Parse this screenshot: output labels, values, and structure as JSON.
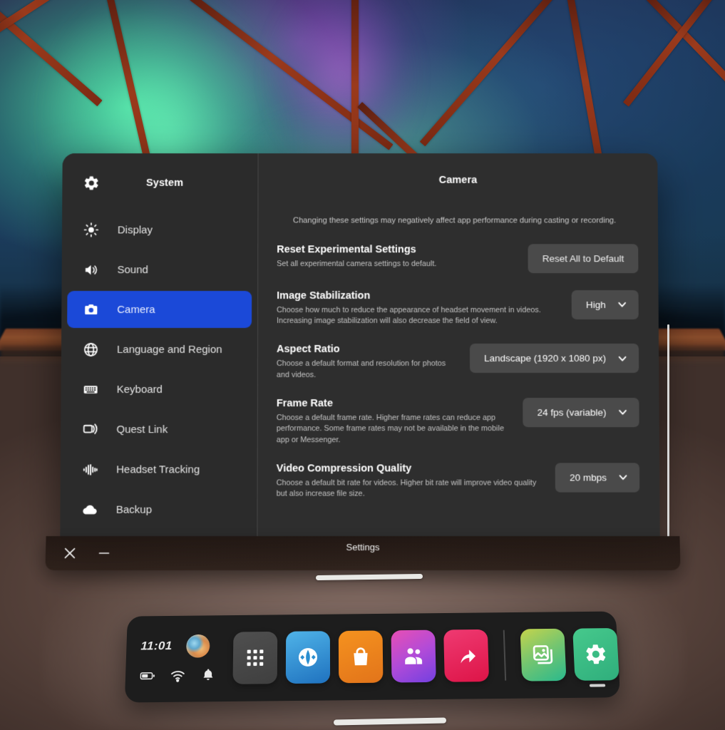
{
  "window": {
    "app_title": "Settings",
    "close_label": "×",
    "minimize_label": "–"
  },
  "sidebar": {
    "header": {
      "label": "System",
      "icon": "gear-icon"
    },
    "items": [
      {
        "label": "Display",
        "icon": "brightness-icon",
        "active": false
      },
      {
        "label": "Sound",
        "icon": "speaker-icon",
        "active": false
      },
      {
        "label": "Camera",
        "icon": "camera-icon",
        "active": true
      },
      {
        "label": "Language and Region",
        "icon": "globe-icon",
        "active": false
      },
      {
        "label": "Keyboard",
        "icon": "keyboard-icon",
        "active": false
      },
      {
        "label": "Quest Link",
        "icon": "cast-icon",
        "active": false
      },
      {
        "label": "Headset Tracking",
        "icon": "waveform-icon",
        "active": false
      },
      {
        "label": "Backup",
        "icon": "cloud-icon",
        "active": false
      }
    ],
    "active_color": "#1b49d8"
  },
  "content": {
    "title": "Camera",
    "clipped_fragment": ".",
    "note": "Changing these settings may negatively affect app performance during casting or recording.",
    "rows": [
      {
        "title": "Reset Experimental Settings",
        "desc": "Set all experimental camera settings to default.",
        "control_type": "button",
        "control_value": "Reset All to Default"
      },
      {
        "title": "Image Stabilization",
        "desc": "Choose how much to reduce the appearance of headset movement in videos. Increasing image stabilization will also decrease the field of view.",
        "control_type": "dropdown",
        "control_value": "High"
      },
      {
        "title": "Aspect Ratio",
        "desc": "Choose a default format and resolution for photos and videos.",
        "control_type": "dropdown",
        "control_value": "Landscape (1920 x 1080 px)"
      },
      {
        "title": "Frame Rate",
        "desc": "Choose a default frame rate. Higher frame rates can reduce app performance. Some frame rates may not be available in the mobile app or Messenger.",
        "control_type": "dropdown",
        "control_value": "24 fps (variable)"
      },
      {
        "title": "Video Compression Quality",
        "desc": "Choose a default bit rate for videos. Higher bit rate will improve video quality but also increase file size.",
        "control_type": "dropdown",
        "control_value": "20 mbps"
      }
    ]
  },
  "dock": {
    "clock": "11:01",
    "avatar": "user-avatar",
    "status_icons": [
      {
        "name": "battery-icon"
      },
      {
        "name": "wifi-icon"
      },
      {
        "name": "notifications-bell-icon"
      }
    ],
    "apps": [
      {
        "name": "app-library-grid-icon",
        "color_start": "#4a4a4a",
        "color_end": "#4a4a4a",
        "running": false
      },
      {
        "name": "explore-icon",
        "color_start": "#3aa7e0",
        "color_end": "#1f78c6",
        "running": false
      },
      {
        "name": "store-bag-icon",
        "color_start": "#f08a1e",
        "color_end": "#e0761a",
        "running": false
      },
      {
        "name": "people-icon",
        "color_start": "#e04ab0",
        "color_end": "#7b3fe0",
        "running": false
      },
      {
        "name": "share-arrow-icon",
        "color_start": "#e8336b",
        "color_end": "#e21b4e",
        "running": false
      }
    ],
    "pinned_apps": [
      {
        "name": "gallery-photos-icon",
        "color_start": "#bcd24a",
        "color_end": "#2fb98a",
        "running": false
      },
      {
        "name": "settings-gear-icon",
        "color_start": "#3cc08a",
        "color_end": "#2fae7a",
        "running": true
      }
    ],
    "separator": "dock-separator"
  },
  "environment": {
    "name": "aurora-geodesic-dome",
    "grab_bar_window": "window-grab-handle",
    "grab_bar_bottom": "system-grab-handle"
  }
}
